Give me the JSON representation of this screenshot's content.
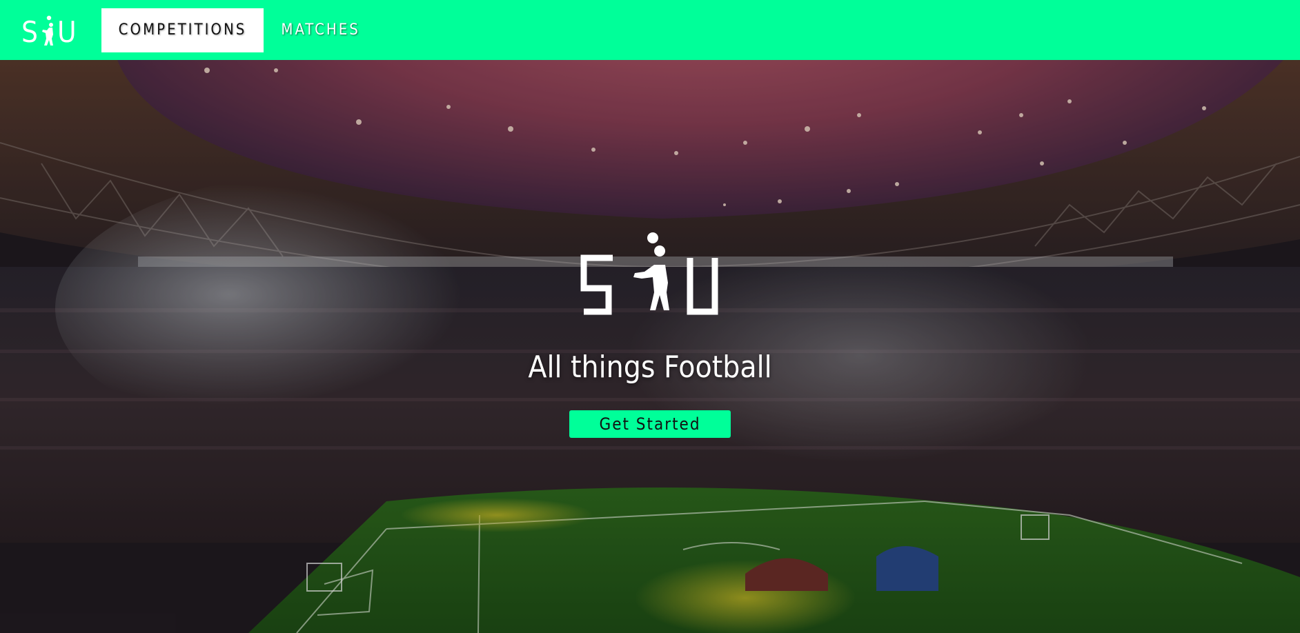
{
  "brand": {
    "logo_letter_left": "S",
    "logo_letter_right": "U",
    "logo_icon": "football-player-silhouette-icon"
  },
  "nav": {
    "tabs": [
      {
        "label": "COMPETITIONS",
        "active": true
      },
      {
        "label": "MATCHES",
        "active": false
      }
    ]
  },
  "hero": {
    "tagline": "All things Football",
    "cta_label": "Get Started",
    "background": "stadium-fireworks-image"
  },
  "colors": {
    "accent": "#00ff99",
    "text_light": "#ffffff",
    "text_dark": "#111111"
  }
}
